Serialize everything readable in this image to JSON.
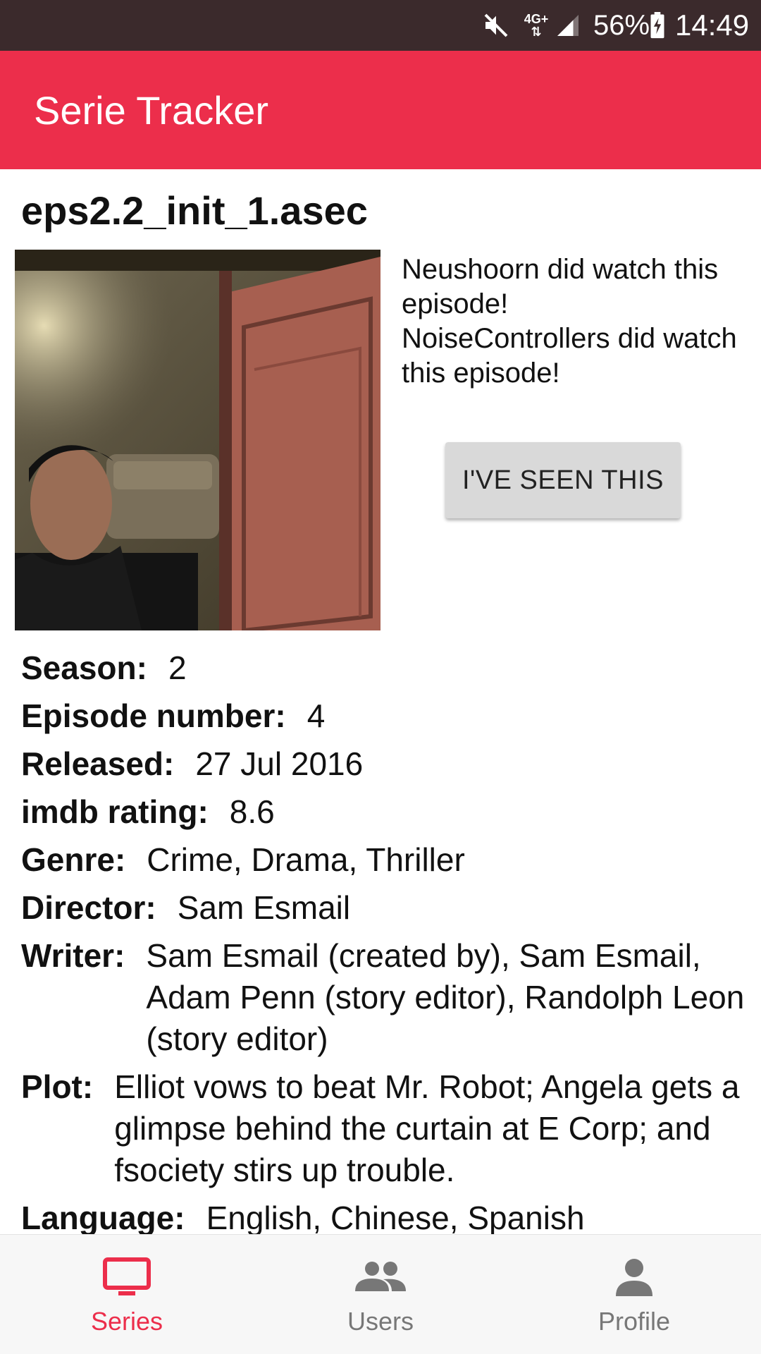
{
  "status_bar": {
    "network": "4G+",
    "battery": "56%",
    "time": "14:49",
    "icons": [
      "mute-icon",
      "network-icon",
      "signal-icon",
      "battery-charging-icon"
    ]
  },
  "app_bar": {
    "title": "Serie Tracker"
  },
  "episode": {
    "title": "eps2.2_init_1.asec",
    "watched_by": [
      "Neushoorn did watch this episode!",
      "NoiseControllers did watch this episode!"
    ],
    "seen_button": "I'VE SEEN THIS",
    "details": {
      "season": {
        "label": "Season:",
        "value": "2"
      },
      "episode_number": {
        "label": "Episode number:",
        "value": "4"
      },
      "released": {
        "label": "Released:",
        "value": "27 Jul 2016"
      },
      "imdb_rating": {
        "label": "imdb rating:",
        "value": "8.6"
      },
      "genre": {
        "label": "Genre:",
        "value": "Crime, Drama, Thriller"
      },
      "director": {
        "label": "Director:",
        "value": "Sam Esmail"
      },
      "writer": {
        "label": "Writer:",
        "value": "Sam Esmail (created by), Sam Esmail, Adam Penn (story editor), Randolph Leon (story editor)"
      },
      "plot": {
        "label": "Plot:",
        "value": "Elliot vows to beat Mr. Robot; Angela gets a glimpse behind the curtain at E Corp; and fsociety stirs up trouble."
      },
      "language": {
        "label": "Language:",
        "value": "English, Chinese, Spanish"
      }
    }
  },
  "bottom_nav": {
    "items": [
      {
        "label": "Series",
        "icon": "tv-icon",
        "active": true
      },
      {
        "label": "Users",
        "icon": "users-icon",
        "active": false
      },
      {
        "label": "Profile",
        "icon": "person-icon",
        "active": false
      }
    ]
  },
  "colors": {
    "accent": "#ec2e4b",
    "status_bar": "#3b2a2c",
    "nav_inactive": "#777777"
  }
}
